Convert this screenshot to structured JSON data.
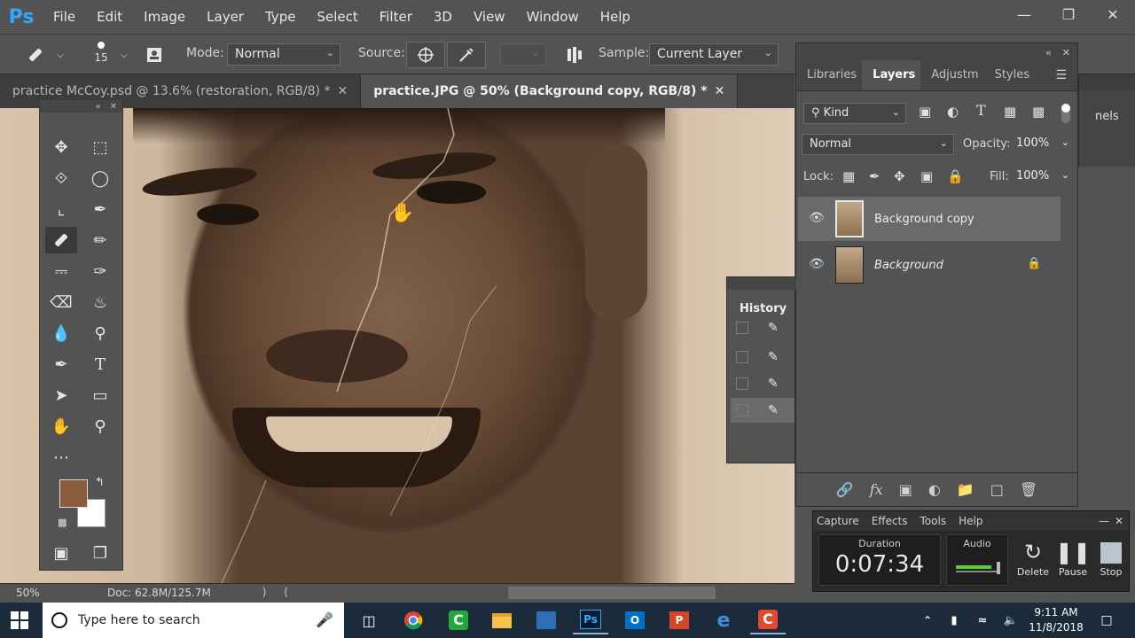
{
  "app": {
    "logo": "Ps",
    "menu": [
      "File",
      "Edit",
      "Image",
      "Layer",
      "Type",
      "Select",
      "Filter",
      "3D",
      "View",
      "Window",
      "Help"
    ],
    "window_controls": {
      "minimize_icon": "minimize-icon",
      "restore_icon": "restore-icon",
      "close_icon": "close-icon"
    }
  },
  "options_bar": {
    "brush_size": "15",
    "mode_label": "Mode:",
    "mode_value": "Normal",
    "source_label": "Source:",
    "sample_label": "Sample:",
    "sample_value": "Current Layer"
  },
  "doc_tabs": [
    {
      "title": "practice McCoy.psd @ 13.6% (restoration, RGB/8) *",
      "active": false
    },
    {
      "title": "practice.JPG @ 50% (Background copy, RGB/8) *",
      "active": true
    }
  ],
  "layers_panel": {
    "tabs": [
      "Libraries",
      "Layers",
      "Adjustm",
      "Styles"
    ],
    "active_tab": "Layers",
    "filter_value": "Kind",
    "blend_mode": "Normal",
    "opacity_label": "Opacity:",
    "opacity_value": "100%",
    "lock_label": "Lock:",
    "fill_label": "Fill:",
    "fill_value": "100%",
    "layers": [
      {
        "name": "Background copy",
        "selected": true,
        "locked": false
      },
      {
        "name": "Background",
        "selected": false,
        "locked": true
      }
    ],
    "side_label": "nels"
  },
  "history_panel": {
    "title": "History",
    "state_count": 4
  },
  "status_bar": {
    "zoom": "50%",
    "doc_info": "Doc: 62.8M/125.7M"
  },
  "recorder": {
    "menu": [
      "Capture",
      "Effects",
      "Tools",
      "Help"
    ],
    "duration_label": "Duration",
    "duration_value": "0:07:34",
    "audio_label": "Audio",
    "delete_label": "Delete",
    "pause_label": "Pause",
    "stop_label": "Stop"
  },
  "taskbar": {
    "search_placeholder": "Type here to search",
    "time": "9:11 AM",
    "date": "11/8/2018",
    "ps_label": "Ps"
  },
  "colors": {
    "foreground": "#8a5a3a",
    "background": "#ffffff",
    "ps_blue": "#31a8ff"
  }
}
